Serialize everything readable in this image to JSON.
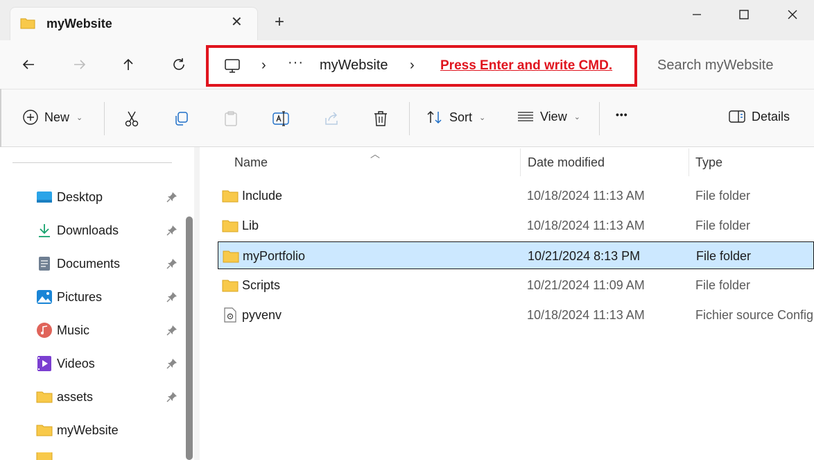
{
  "tab": {
    "title": "myWebsite",
    "close_glyph": "✕",
    "new_tab_glyph": "+"
  },
  "address": {
    "separator": "›",
    "overflow": "···",
    "folder": "myWebsite",
    "instruction": "Press Enter and write CMD."
  },
  "search": {
    "placeholder": "Search myWebsite"
  },
  "commands": {
    "new_label": "New",
    "sort_label": "Sort",
    "view_label": "View",
    "more_label": "•••",
    "details_label": "Details",
    "chevron": "⌄"
  },
  "sidebar": {
    "items": [
      {
        "label": "Desktop",
        "icon": "desktop-icon",
        "pinned": true
      },
      {
        "label": "Downloads",
        "icon": "download-icon",
        "pinned": true
      },
      {
        "label": "Documents",
        "icon": "documents-icon",
        "pinned": true
      },
      {
        "label": "Pictures",
        "icon": "pictures-icon",
        "pinned": true
      },
      {
        "label": "Music",
        "icon": "music-icon",
        "pinned": true
      },
      {
        "label": "Videos",
        "icon": "videos-icon",
        "pinned": true
      },
      {
        "label": "assets",
        "icon": "folder-icon",
        "pinned": true
      },
      {
        "label": "myWebsite",
        "icon": "folder-icon",
        "pinned": false
      }
    ]
  },
  "columns": {
    "name": "Name",
    "date": "Date modified",
    "type": "Type"
  },
  "files": [
    {
      "name": "Include",
      "date": "10/18/2024 11:13 AM",
      "type": "File folder",
      "icon": "folder-icon",
      "selected": false
    },
    {
      "name": "Lib",
      "date": "10/18/2024 11:13 AM",
      "type": "File folder",
      "icon": "folder-icon",
      "selected": false
    },
    {
      "name": "myPortfolio",
      "date": "10/21/2024 8:13 PM",
      "type": "File folder",
      "icon": "folder-icon",
      "selected": true
    },
    {
      "name": "Scripts",
      "date": "10/21/2024 11:09 AM",
      "type": "File folder",
      "icon": "folder-icon",
      "selected": false
    },
    {
      "name": "pyvenv",
      "date": "10/18/2024 11:13 AM",
      "type": "Fichier source Config...",
      "icon": "config-file-icon",
      "selected": false
    }
  ],
  "colors": {
    "accent": "#e0141e",
    "selection": "#cce8ff",
    "folder": "#f8c94a"
  }
}
